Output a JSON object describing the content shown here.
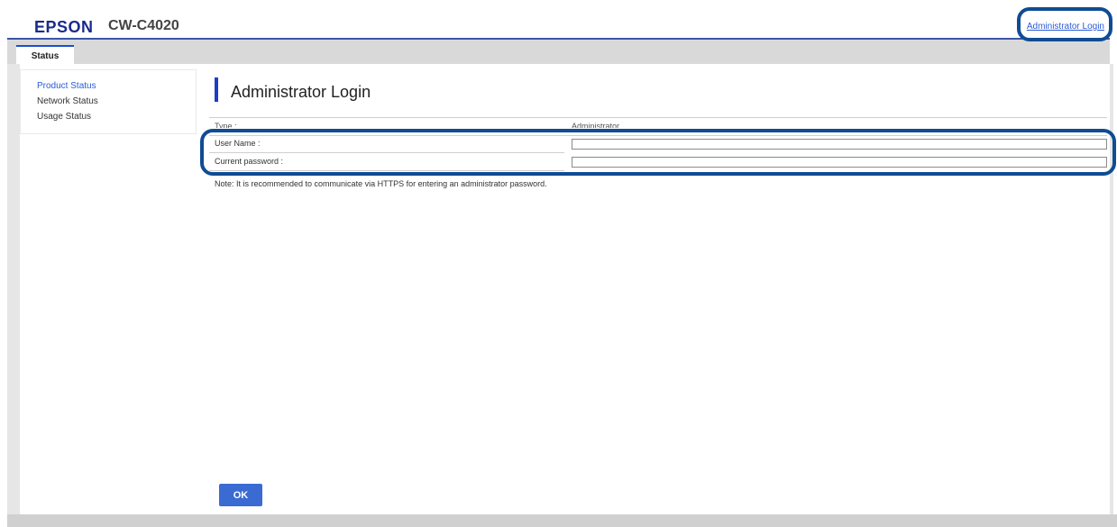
{
  "header": {
    "brand": "EPSON",
    "model": "CW-C4020",
    "admin_login_link": "Administrator Login"
  },
  "tabs": [
    {
      "label": "Status",
      "active": true
    }
  ],
  "sidebar": {
    "items": [
      {
        "label": "Product Status",
        "active": true
      },
      {
        "label": "Network Status",
        "active": false
      },
      {
        "label": "Usage Status",
        "active": false
      }
    ]
  },
  "main": {
    "title": "Administrator Login",
    "type_label": "Type :",
    "type_value": "Administrator",
    "user_name_label": "User Name :",
    "user_name_value": "",
    "password_label": "Current password :",
    "password_value": "",
    "note": "Note: It is recommended to communicate via HTTPS for entering an administrator password.",
    "ok_button": "OK"
  },
  "colors": {
    "brand": "#1a2a8c",
    "accent": "#1a3ec9",
    "link": "#2a5bd7",
    "button": "#3a6bd3",
    "highlight": "#0f4c93"
  }
}
